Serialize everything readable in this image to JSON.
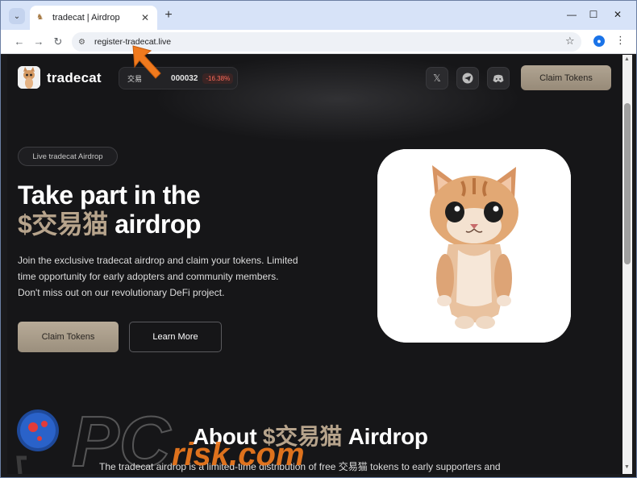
{
  "browser": {
    "tab_title": "tradecat | Airdrop",
    "url": "register-tradecat.live",
    "new_tab_symbol": "+",
    "close_symbol": "✕"
  },
  "header": {
    "brand": "tradecat",
    "ticker_label": "交易",
    "ticker_price": "000032",
    "ticker_change": "-16.38%",
    "claim_button": "Claim Tokens",
    "social_icons": [
      "x-icon",
      "telegram-icon",
      "discord-icon"
    ]
  },
  "hero": {
    "badge": "Live tradecat Airdrop",
    "title_line1": "Take part in the",
    "title_accent": "$交易猫",
    "title_rest": " airdrop",
    "subtitle": "Join the exclusive tradecat airdrop and claim your tokens. Limited time opportunity for early adopters and community members. Don't miss out on our revolutionary DeFi project.",
    "claim_button": "Claim Tokens",
    "learn_button": "Learn More"
  },
  "about": {
    "title_prefix": "About ",
    "title_accent": "$交易猫",
    "title_suffix": " Airdrop",
    "text": "The tradecat airdrop is a limited-time distribution of free 交易猫 tokens to early supporters and"
  },
  "watermark": {
    "text": "risk.com"
  },
  "colors": {
    "accent": "#b7a48c",
    "page_bg": "#161618",
    "negative": "#ff6b5a",
    "arrow": "#f07a1e"
  }
}
